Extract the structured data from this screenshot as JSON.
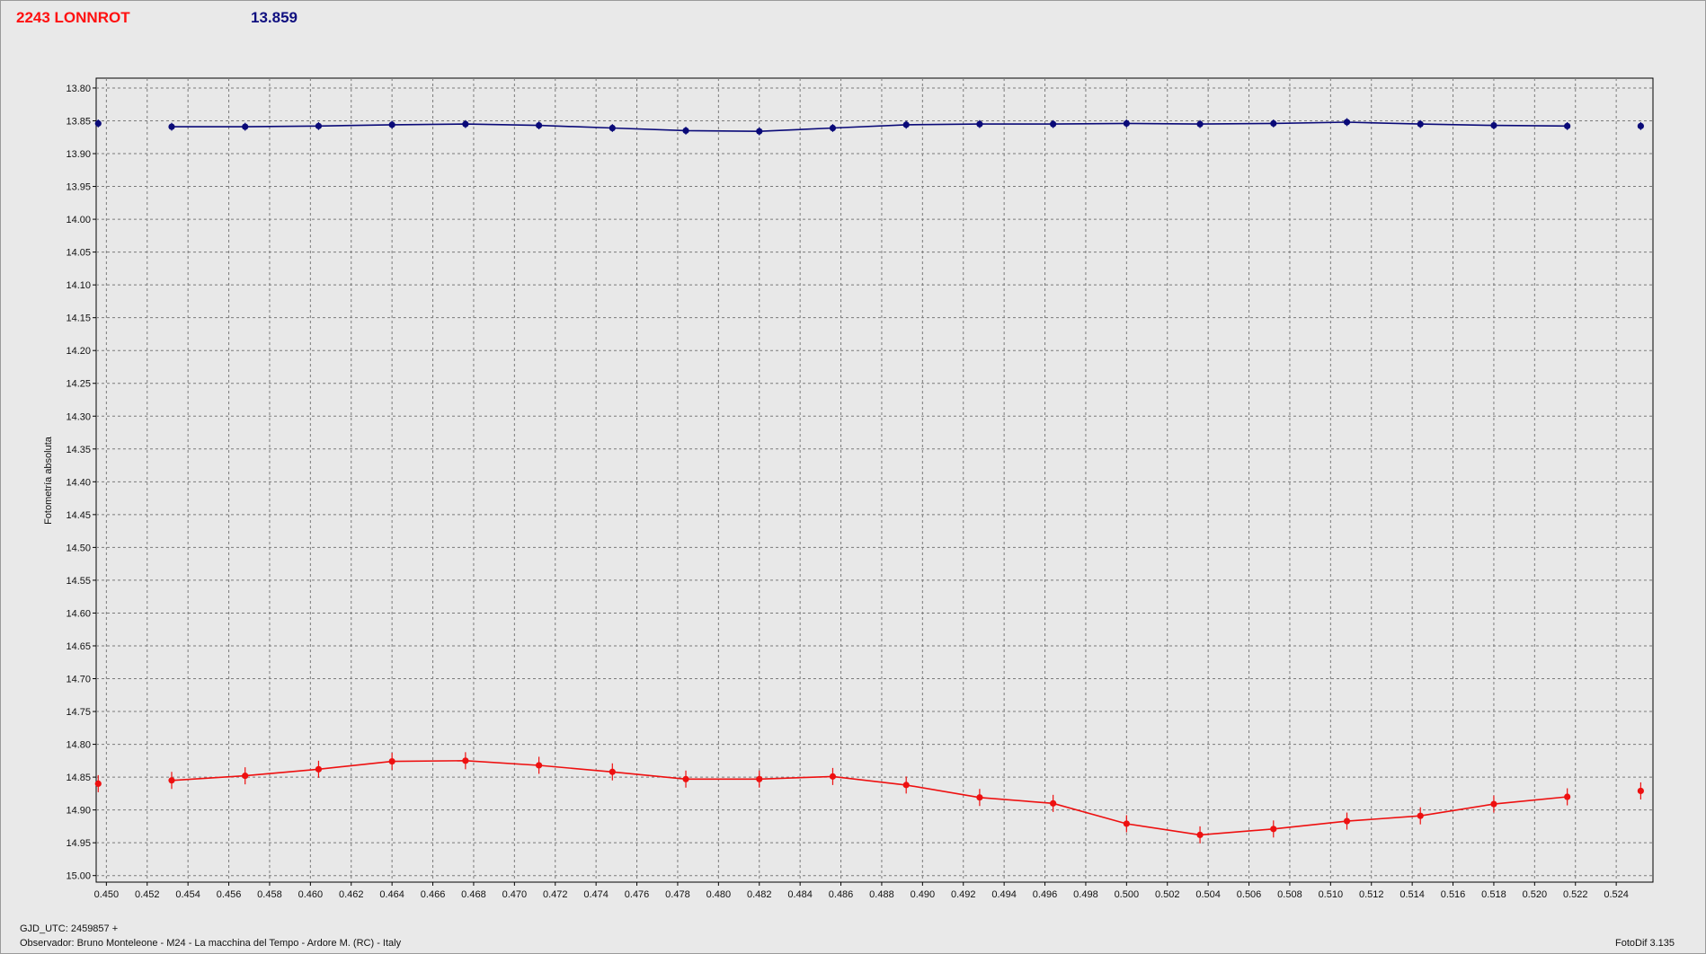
{
  "header": {
    "object_name": "2243 LONNROT",
    "reference_magnitude": "13.859"
  },
  "footer": {
    "gjd": "GJD_UTC: 2459857 +",
    "observer": "Observador: Bruno Monteleone - M24 - La macchina del Tempo - Ardore M. (RC) - Italy",
    "software": "FotoDif 3.135"
  },
  "chart_data": {
    "type": "line",
    "title": "",
    "xlabel": "",
    "ylabel": "Fotometría absoluta",
    "xlim": [
      0.4495,
      0.5258
    ],
    "ylim": [
      13.785,
      15.01
    ],
    "y_inverted": true,
    "grid": true,
    "x_ticks": [
      "0.450",
      "0.452",
      "0.454",
      "0.456",
      "0.458",
      "0.460",
      "0.462",
      "0.464",
      "0.466",
      "0.468",
      "0.470",
      "0.472",
      "0.474",
      "0.476",
      "0.478",
      "0.480",
      "0.482",
      "0.484",
      "0.486",
      "0.488",
      "0.490",
      "0.492",
      "0.494",
      "0.496",
      "0.498",
      "0.500",
      "0.502",
      "0.504",
      "0.506",
      "0.508",
      "0.510",
      "0.512",
      "0.514",
      "0.516",
      "0.518",
      "0.520",
      "0.522",
      "0.524"
    ],
    "y_ticks": [
      "13.80",
      "13.85",
      "13.90",
      "13.95",
      "14.00",
      "14.05",
      "14.10",
      "14.15",
      "14.20",
      "14.25",
      "14.30",
      "14.35",
      "14.40",
      "14.45",
      "14.50",
      "14.55",
      "14.60",
      "14.65",
      "14.70",
      "14.75",
      "14.80",
      "14.85",
      "14.90",
      "14.95",
      "15.00"
    ],
    "series": [
      {
        "color": "#0a0a78",
        "x": [
          0.4496,
          0.4532,
          0.4568,
          0.4604,
          0.464,
          0.4676,
          0.4712,
          0.4748,
          0.4784,
          0.482,
          0.4856,
          0.4892,
          0.4928,
          0.4964,
          0.5,
          0.5036,
          0.5072,
          0.5108,
          0.5144,
          0.518,
          0.5216,
          0.5252
        ],
        "y": [
          13.854,
          13.859,
          13.859,
          13.858,
          13.856,
          13.855,
          13.857,
          13.861,
          13.865,
          13.866,
          13.861,
          13.856,
          13.855,
          13.855,
          13.854,
          13.855,
          13.854,
          13.852,
          13.855,
          13.857,
          13.858,
          13.858
        ],
        "err": [
          0.006,
          0.006,
          0.006,
          0.006,
          0.006,
          0.006,
          0.006,
          0.006,
          0.006,
          0.006,
          0.006,
          0.006,
          0.006,
          0.006,
          0.006,
          0.006,
          0.006,
          0.006,
          0.006,
          0.006,
          0.006,
          0.006
        ],
        "line_from": 1,
        "line_to": 20
      },
      {
        "color": "#ee1010",
        "x": [
          0.4496,
          0.4532,
          0.4568,
          0.4604,
          0.464,
          0.4676,
          0.4712,
          0.4748,
          0.4784,
          0.482,
          0.4856,
          0.4892,
          0.4928,
          0.4964,
          0.5,
          0.5036,
          0.5072,
          0.5108,
          0.5144,
          0.518,
          0.5216,
          0.5252
        ],
        "y": [
          14.86,
          14.855,
          14.848,
          14.838,
          14.826,
          14.825,
          14.832,
          14.842,
          14.853,
          14.853,
          14.849,
          14.862,
          14.881,
          14.89,
          14.921,
          14.938,
          14.929,
          14.917,
          14.909,
          14.891,
          14.88,
          14.871
        ],
        "err": [
          0.013,
          0.013,
          0.013,
          0.013,
          0.013,
          0.013,
          0.013,
          0.013,
          0.013,
          0.013,
          0.013,
          0.013,
          0.013,
          0.013,
          0.013,
          0.013,
          0.013,
          0.013,
          0.013,
          0.013,
          0.013,
          0.013
        ],
        "line_from": 1,
        "line_to": 20
      }
    ]
  }
}
